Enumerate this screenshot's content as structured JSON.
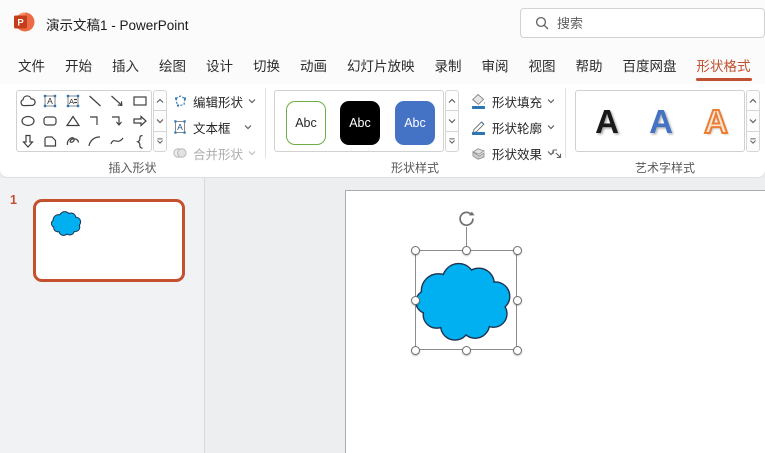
{
  "titlebar": {
    "app_title": "演示文稿1 - PowerPoint",
    "search_placeholder": "搜索"
  },
  "tabs": [
    {
      "label": "文件",
      "active": false
    },
    {
      "label": "开始",
      "active": false
    },
    {
      "label": "插入",
      "active": false
    },
    {
      "label": "绘图",
      "active": false
    },
    {
      "label": "设计",
      "active": false
    },
    {
      "label": "切换",
      "active": false
    },
    {
      "label": "动画",
      "active": false
    },
    {
      "label": "幻灯片放映",
      "active": false
    },
    {
      "label": "录制",
      "active": false
    },
    {
      "label": "审阅",
      "active": false
    },
    {
      "label": "视图",
      "active": false
    },
    {
      "label": "帮助",
      "active": false
    },
    {
      "label": "百度网盘",
      "active": false
    },
    {
      "label": "形状格式",
      "active": true
    }
  ],
  "ribbon": {
    "insert_shapes": {
      "label": "插入形状",
      "edit_shape": "编辑形状",
      "text_box": "文本框",
      "merge_shapes": "合并形状"
    },
    "shape_styles": {
      "label": "形状样式",
      "previews": [
        "Abc",
        "Abc",
        "Abc"
      ],
      "fill": "形状填充",
      "outline": "形状轮廓",
      "effects": "形状效果"
    },
    "wordart": {
      "label": "艺术字样式",
      "previews": [
        "A",
        "A",
        "A"
      ]
    }
  },
  "slides_panel": {
    "slide_number": "1"
  },
  "icons": {
    "letter_a": "A",
    "powerpoint-logo": "orange circle with P tile",
    "search-icon": "magnifying glass",
    "chevron-down-icon": "v chevron",
    "rotate-icon": "circular arrow",
    "dialog-launcher-icon": "corner diagonal arrow",
    "shape-fill-icon": "paint bucket with blue bar",
    "shape-outline-icon": "pencil with blue bar",
    "shape-effects-icon": "gray 3d slab"
  },
  "colors": {
    "accent": "#C0502F",
    "thumbnail_border": "#C4502E",
    "cloud_fill": "#00B0F0",
    "cloud_outline": "#1F3350",
    "style_blue": "#4472C4",
    "style_green_border": "#70AD47",
    "wordart_orange": "#ED7D31"
  }
}
